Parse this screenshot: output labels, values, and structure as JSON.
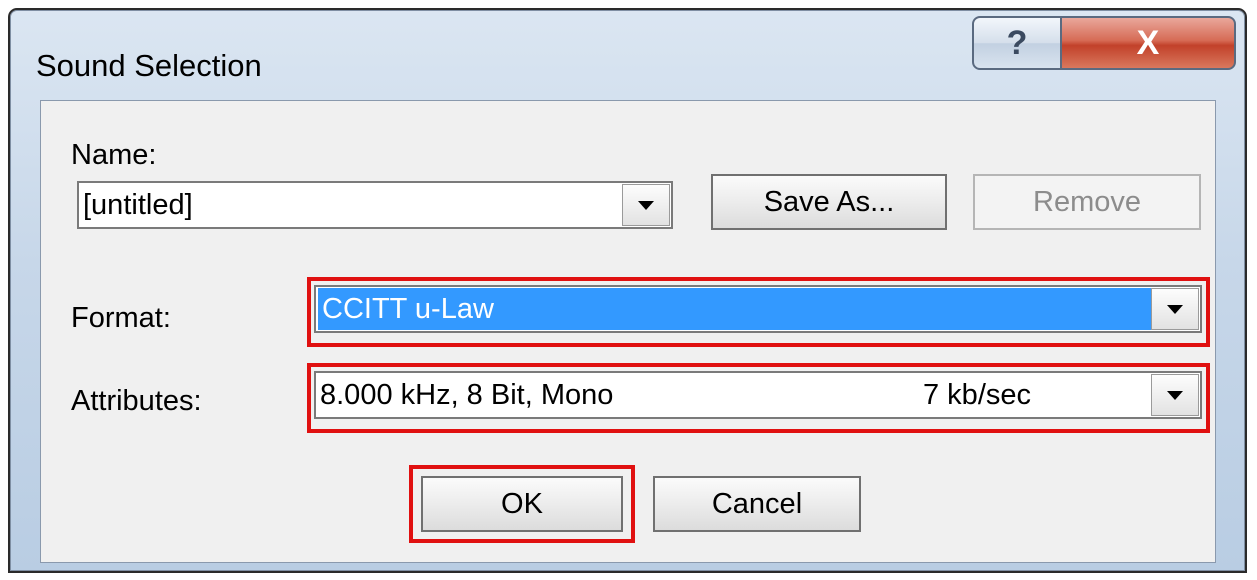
{
  "window": {
    "title": "Sound Selection"
  },
  "caption_buttons": {
    "help": "?",
    "close": "X"
  },
  "name": {
    "label": "Name:",
    "value": "[untitled]"
  },
  "buttons": {
    "save_as": "Save As...",
    "remove": "Remove",
    "ok": "OK",
    "cancel": "Cancel"
  },
  "format": {
    "label": "Format:",
    "value": "CCITT u-Law"
  },
  "attributes": {
    "label": "Attributes:",
    "value": "8.000 kHz, 8 Bit, Mono",
    "rate": "7 kb/sec"
  },
  "colors": {
    "highlight": "#e01010",
    "selection": "#3399ff",
    "close_button": "#c2412a"
  }
}
